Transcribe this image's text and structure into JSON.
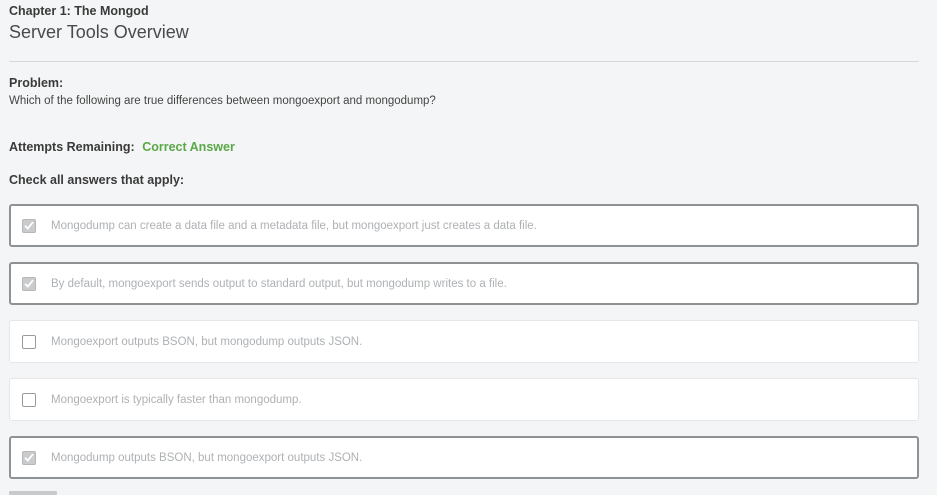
{
  "header": {
    "chapter": "Chapter 1: The Mongod",
    "title": "Server Tools Overview"
  },
  "problem": {
    "label": "Problem:",
    "text": "Which of the following are true differences between mongoexport and mongodump?"
  },
  "attempts": {
    "label": "Attempts Remaining:",
    "status": "Correct Answer",
    "status_color": "#5aa848"
  },
  "instructions": "Check all answers that apply:",
  "answers": [
    {
      "text": "Mongodump can create a data file and a metadata file, but mongoexport just creates a data file.",
      "checked": true
    },
    {
      "text": "By default, mongoexport sends output to standard output, but mongodump writes to a file.",
      "checked": true
    },
    {
      "text": "Mongoexport outputs BSON, but mongodump outputs JSON.",
      "checked": false
    },
    {
      "text": "Mongoexport is typically faster than mongodump.",
      "checked": false
    },
    {
      "text": "Mongodump outputs BSON, but mongoexport outputs JSON.",
      "checked": true
    }
  ],
  "icons": {
    "checkbox_checked": "check-icon"
  }
}
